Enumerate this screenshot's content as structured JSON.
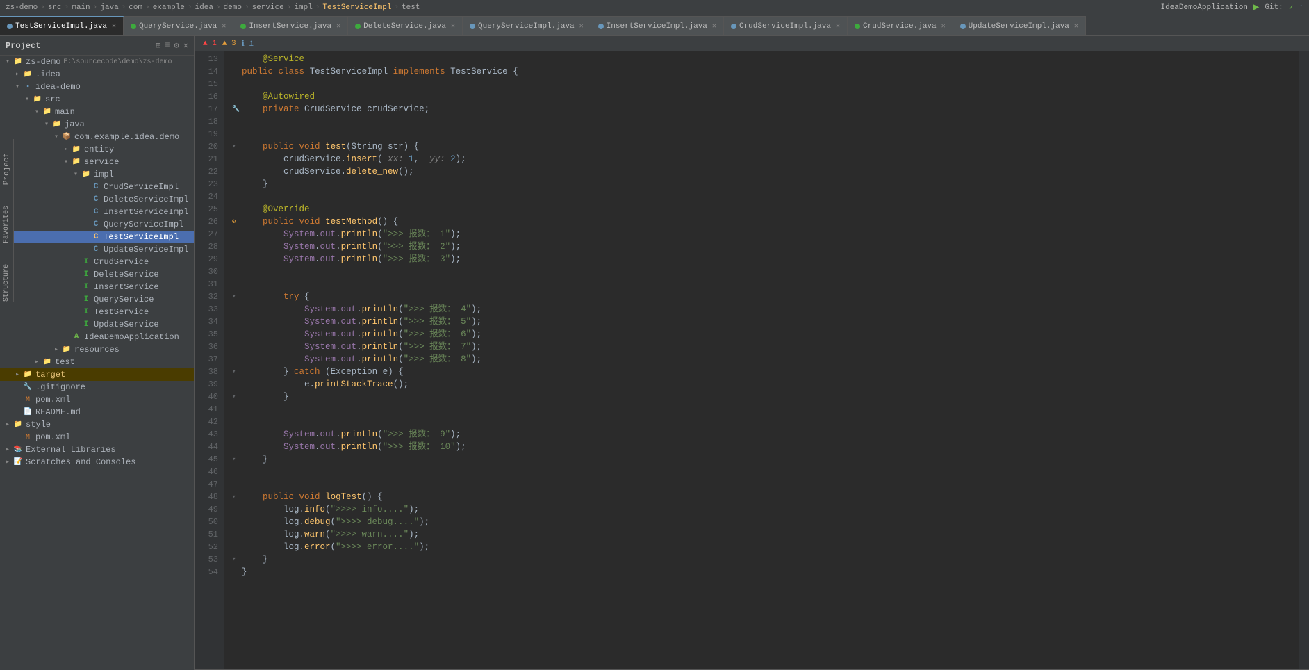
{
  "topbar": {
    "breadcrumb": [
      "zs-demo",
      "src",
      "main",
      "java",
      "com",
      "example",
      "idea",
      "demo",
      "service",
      "impl",
      "TestServiceImpl",
      "test"
    ],
    "app_name": "IdeaDemoApplication",
    "git_label": "Git:"
  },
  "tabs": [
    {
      "label": "TestServiceImpl.java",
      "color": "#6897bb",
      "active": true
    },
    {
      "label": "QueryService.java",
      "color": "#3daa3d",
      "active": false
    },
    {
      "label": "InsertService.java",
      "color": "#3daa3d",
      "active": false
    },
    {
      "label": "DeleteService.java",
      "color": "#3daa3d",
      "active": false
    },
    {
      "label": "QueryServiceImpl.java",
      "color": "#6897bb",
      "active": false
    },
    {
      "label": "InsertServiceImpl.java",
      "color": "#6897bb",
      "active": false
    },
    {
      "label": "CrudServiceImpl.java",
      "color": "#6897bb",
      "active": false
    },
    {
      "label": "CrudService.java",
      "color": "#3daa3d",
      "active": false
    },
    {
      "label": "UpdateServiceImpl.java",
      "color": "#6897bb",
      "active": false
    }
  ],
  "sidebar": {
    "title": "Project",
    "tree": [
      {
        "id": "project",
        "label": "Project",
        "depth": 0,
        "type": "header",
        "expanded": true
      },
      {
        "id": "zs-demo",
        "label": "zs-demo",
        "depth": 0,
        "type": "project",
        "expanded": true,
        "path": "E:\\sourcecode\\demo\\zs-demo"
      },
      {
        "id": "idea",
        "label": ".idea",
        "depth": 1,
        "type": "folder",
        "expanded": false
      },
      {
        "id": "idea-demo",
        "label": "idea-demo",
        "depth": 1,
        "type": "module",
        "expanded": true
      },
      {
        "id": "src",
        "label": "src",
        "depth": 2,
        "type": "folder",
        "expanded": true
      },
      {
        "id": "main",
        "label": "main",
        "depth": 3,
        "type": "folder",
        "expanded": true
      },
      {
        "id": "java",
        "label": "java",
        "depth": 4,
        "type": "folder",
        "expanded": true
      },
      {
        "id": "com",
        "label": "com.example.idea.demo",
        "depth": 5,
        "type": "package",
        "expanded": true
      },
      {
        "id": "entity",
        "label": "entity",
        "depth": 6,
        "type": "folder",
        "expanded": false
      },
      {
        "id": "service",
        "label": "service",
        "depth": 6,
        "type": "folder",
        "expanded": true
      },
      {
        "id": "impl",
        "label": "impl",
        "depth": 7,
        "type": "folder",
        "expanded": true
      },
      {
        "id": "CrudServiceImpl",
        "label": "CrudServiceImpl",
        "depth": 8,
        "type": "class",
        "expanded": false
      },
      {
        "id": "DeleteServiceImpl",
        "label": "DeleteServiceImpl",
        "depth": 8,
        "type": "class",
        "expanded": false
      },
      {
        "id": "InsertServiceImpl",
        "label": "InsertServiceImpl",
        "depth": 8,
        "type": "class",
        "expanded": false
      },
      {
        "id": "QueryServiceImpl",
        "label": "QueryServiceImpl",
        "depth": 8,
        "type": "class",
        "expanded": false
      },
      {
        "id": "TestServiceImpl",
        "label": "TestServiceImpl",
        "depth": 8,
        "type": "class",
        "expanded": false,
        "selected": true
      },
      {
        "id": "UpdateServiceImpl",
        "label": "UpdateServiceImpl",
        "depth": 8,
        "type": "class",
        "expanded": false
      },
      {
        "id": "CrudService",
        "label": "CrudService",
        "depth": 7,
        "type": "interface",
        "expanded": false
      },
      {
        "id": "DeleteService",
        "label": "DeleteService",
        "depth": 7,
        "type": "interface",
        "expanded": false
      },
      {
        "id": "InsertService",
        "label": "InsertService",
        "depth": 7,
        "type": "interface",
        "expanded": false
      },
      {
        "id": "QueryService",
        "label": "QueryService",
        "depth": 7,
        "type": "interface",
        "expanded": false
      },
      {
        "id": "TestService",
        "label": "TestService",
        "depth": 7,
        "type": "interface",
        "expanded": false
      },
      {
        "id": "UpdateService",
        "label": "UpdateService",
        "depth": 7,
        "type": "interface",
        "expanded": false
      },
      {
        "id": "IdeaDemoApplication",
        "label": "IdeaDemoApplication",
        "depth": 6,
        "type": "app",
        "expanded": false
      },
      {
        "id": "resources",
        "label": "resources",
        "depth": 4,
        "type": "folder",
        "expanded": false
      },
      {
        "id": "test",
        "label": "test",
        "depth": 2,
        "type": "folder",
        "expanded": false
      },
      {
        "id": "target",
        "label": "target",
        "depth": 1,
        "type": "folder",
        "expanded": false,
        "highlighted": true
      },
      {
        "id": "gitignore",
        "label": ".gitignore",
        "depth": 1,
        "type": "git"
      },
      {
        "id": "pom-xml",
        "label": "pom.xml",
        "depth": 1,
        "type": "xml"
      },
      {
        "id": "readme",
        "label": "README.md",
        "depth": 1,
        "type": "md"
      },
      {
        "id": "style",
        "label": "style",
        "depth": 0,
        "type": "folder",
        "expanded": false
      },
      {
        "id": "pom-xml2",
        "label": "pom.xml",
        "depth": 1,
        "type": "xml"
      },
      {
        "id": "external-libs",
        "label": "External Libraries",
        "depth": 0,
        "type": "lib",
        "expanded": false
      },
      {
        "id": "scratches",
        "label": "Scratches and Consoles",
        "depth": 0,
        "type": "scratch",
        "expanded": false
      }
    ]
  },
  "notification": {
    "errors": "▲ 1",
    "warnings": "▲ 3",
    "info": "ℹ 1"
  },
  "code": {
    "lines": [
      {
        "n": 13,
        "text": "    @Service",
        "type": "annotation"
      },
      {
        "n": 14,
        "text": "public class TestServiceImpl implements TestService {",
        "type": "class-decl"
      },
      {
        "n": 15,
        "text": "",
        "type": "empty"
      },
      {
        "n": 16,
        "text": "    @Autowired",
        "type": "annotation"
      },
      {
        "n": 17,
        "text": "    private CrudService crudService;",
        "type": "field"
      },
      {
        "n": 18,
        "text": "",
        "type": "empty"
      },
      {
        "n": 19,
        "text": "",
        "type": "empty"
      },
      {
        "n": 20,
        "text": "    public void test(String str) {",
        "type": "method"
      },
      {
        "n": 21,
        "text": "        crudService.insert( xx: 1,  yy: 2);",
        "type": "stmt"
      },
      {
        "n": 22,
        "text": "        crudService.delete_new();",
        "type": "stmt"
      },
      {
        "n": 23,
        "text": "    }",
        "type": "close"
      },
      {
        "n": 24,
        "text": "",
        "type": "empty"
      },
      {
        "n": 25,
        "text": "    @Override",
        "type": "annotation"
      },
      {
        "n": 26,
        "text": "    public void testMethod() {",
        "type": "method"
      },
      {
        "n": 27,
        "text": "        System.out.println(\">>> 报数： 1\");",
        "type": "stmt"
      },
      {
        "n": 28,
        "text": "        System.out.println(\">>> 报数： 2\");",
        "type": "stmt"
      },
      {
        "n": 29,
        "text": "        System.out.println(\">>> 报数： 3\");",
        "type": "stmt"
      },
      {
        "n": 30,
        "text": "",
        "type": "empty"
      },
      {
        "n": 31,
        "text": "",
        "type": "empty"
      },
      {
        "n": 32,
        "text": "        try {",
        "type": "try"
      },
      {
        "n": 33,
        "text": "            System.out.println(\">>> 报数： 4\");",
        "type": "stmt"
      },
      {
        "n": 34,
        "text": "            System.out.println(\">>> 报数： 5\");",
        "type": "stmt"
      },
      {
        "n": 35,
        "text": "            System.out.println(\">>> 报数： 6\");",
        "type": "stmt"
      },
      {
        "n": 36,
        "text": "            System.out.println(\">>> 报数： 7\");",
        "type": "stmt"
      },
      {
        "n": 37,
        "text": "            System.out.println(\">>> 报数： 8\");",
        "type": "stmt"
      },
      {
        "n": 38,
        "text": "        } catch (Exception e) {",
        "type": "catch"
      },
      {
        "n": 39,
        "text": "            e.printStackTrace();",
        "type": "stmt"
      },
      {
        "n": 40,
        "text": "        }",
        "type": "close"
      },
      {
        "n": 41,
        "text": "",
        "type": "empty"
      },
      {
        "n": 42,
        "text": "",
        "type": "empty"
      },
      {
        "n": 43,
        "text": "        System.out.println(\">>> 报数： 9\");",
        "type": "stmt"
      },
      {
        "n": 44,
        "text": "        System.out.println(\">>> 报数： 10\");",
        "type": "stmt"
      },
      {
        "n": 45,
        "text": "    }",
        "type": "close"
      },
      {
        "n": 46,
        "text": "",
        "type": "empty"
      },
      {
        "n": 47,
        "text": "",
        "type": "empty"
      },
      {
        "n": 48,
        "text": "    public void logTest() {",
        "type": "method"
      },
      {
        "n": 49,
        "text": "        log.info(\">>>> info....\");",
        "type": "stmt"
      },
      {
        "n": 50,
        "text": "        log.debug(\">>>> debug....\");",
        "type": "stmt"
      },
      {
        "n": 51,
        "text": "        log.warn(\">>>> warn....\");",
        "type": "stmt"
      },
      {
        "n": 52,
        "text": "        log.error(\">>>> error....\");",
        "type": "stmt"
      },
      {
        "n": 53,
        "text": "    }",
        "type": "close"
      },
      {
        "n": 54,
        "text": "}",
        "type": "close"
      }
    ]
  }
}
